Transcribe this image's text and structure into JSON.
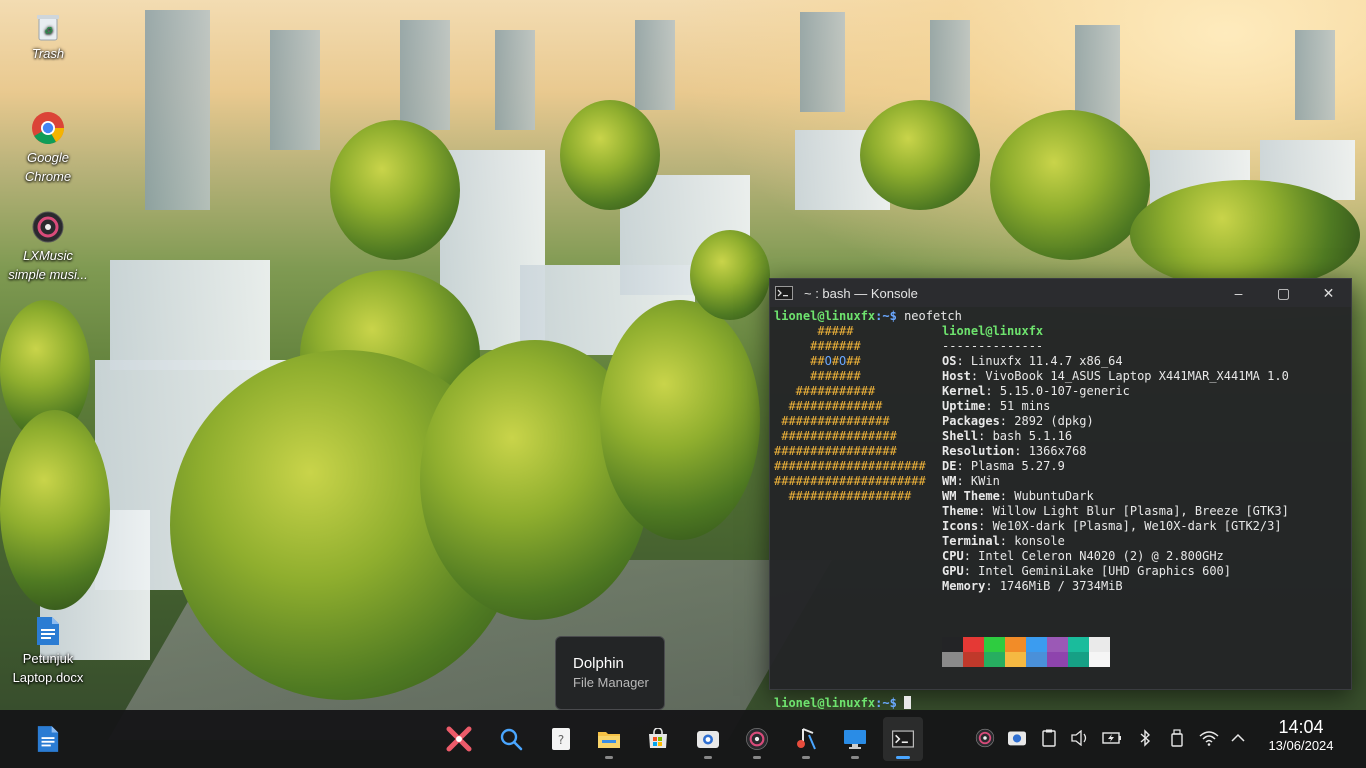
{
  "desktop": {
    "icons": [
      {
        "label": "Trash"
      },
      {
        "label": "Google\nChrome"
      },
      {
        "label": "LXMusic\nsimple musi..."
      },
      {
        "label": "Petunjuk\nLaptop.docx"
      }
    ]
  },
  "konsole": {
    "title": "~ : bash — Konsole",
    "controls": {
      "minimize": "–",
      "maximize": "▢",
      "close": "✕"
    },
    "prompt_user": "lionel@linuxfx",
    "prompt_path": ":~$",
    "command": " neofetch",
    "logo_lines": [
      "      #####",
      "     #######",
      "     ##O#O##",
      "     #######",
      "   ###########",
      "  #############",
      " ###############",
      " ################",
      "#################",
      "#####################",
      "#####################",
      "  #################"
    ],
    "header": "lionel@linuxfx",
    "separator": "--------------",
    "info": [
      {
        "k": "OS",
        "v": "Linuxfx 11.4.7 x86_64"
      },
      {
        "k": "Host",
        "v": "VivoBook 14_ASUS Laptop X441MAR_X441MA 1.0"
      },
      {
        "k": "Kernel",
        "v": "5.15.0-107-generic"
      },
      {
        "k": "Uptime",
        "v": "51 mins"
      },
      {
        "k": "Packages",
        "v": "2892 (dpkg)"
      },
      {
        "k": "Shell",
        "v": "bash 5.1.16"
      },
      {
        "k": "Resolution",
        "v": "1366x768"
      },
      {
        "k": "DE",
        "v": "Plasma 5.27.9"
      },
      {
        "k": "WM",
        "v": "KWin"
      },
      {
        "k": "WM Theme",
        "v": "WubuntuDark"
      },
      {
        "k": "Theme",
        "v": "Willow Light Blur [Plasma], Breeze [GTK3]"
      },
      {
        "k": "Icons",
        "v": "We10X-dark [Plasma], We10X-dark [GTK2/3]"
      },
      {
        "k": "Terminal",
        "v": "konsole"
      },
      {
        "k": "CPU",
        "v": "Intel Celeron N4020 (2) @ 2.800GHz"
      },
      {
        "k": "GPU",
        "v": "Intel GeminiLake [UHD Graphics 600]"
      },
      {
        "k": "Memory",
        "v": "1746MiB / 3734MiB"
      }
    ],
    "palette_top": [
      "#232426",
      "#e53935",
      "#2ecc40",
      "#f28c28",
      "#3b9cf0",
      "#9b59b6",
      "#1abc9c",
      "#eaeaea"
    ],
    "palette_bottom": [
      "#8a8a8a",
      "#c0392b",
      "#27ae60",
      "#f5b942",
      "#4a90d9",
      "#8e44ad",
      "#16a085",
      "#f5f5f5"
    ]
  },
  "tooltip": {
    "title": "Dolphin",
    "subtitle": "File Manager"
  },
  "taskbar": {
    "apps": [
      {
        "name": "start-menu-icon"
      },
      {
        "name": "search-icon"
      },
      {
        "name": "notes-icon"
      },
      {
        "name": "file-manager-icon"
      },
      {
        "name": "store-icon"
      },
      {
        "name": "screenshot-icon"
      },
      {
        "name": "music-player-icon"
      },
      {
        "name": "music-app-icon"
      },
      {
        "name": "remote-desktop-icon"
      },
      {
        "name": "terminal-icon"
      }
    ],
    "clock": {
      "time": "14:04",
      "date": "13/06/2024"
    }
  }
}
